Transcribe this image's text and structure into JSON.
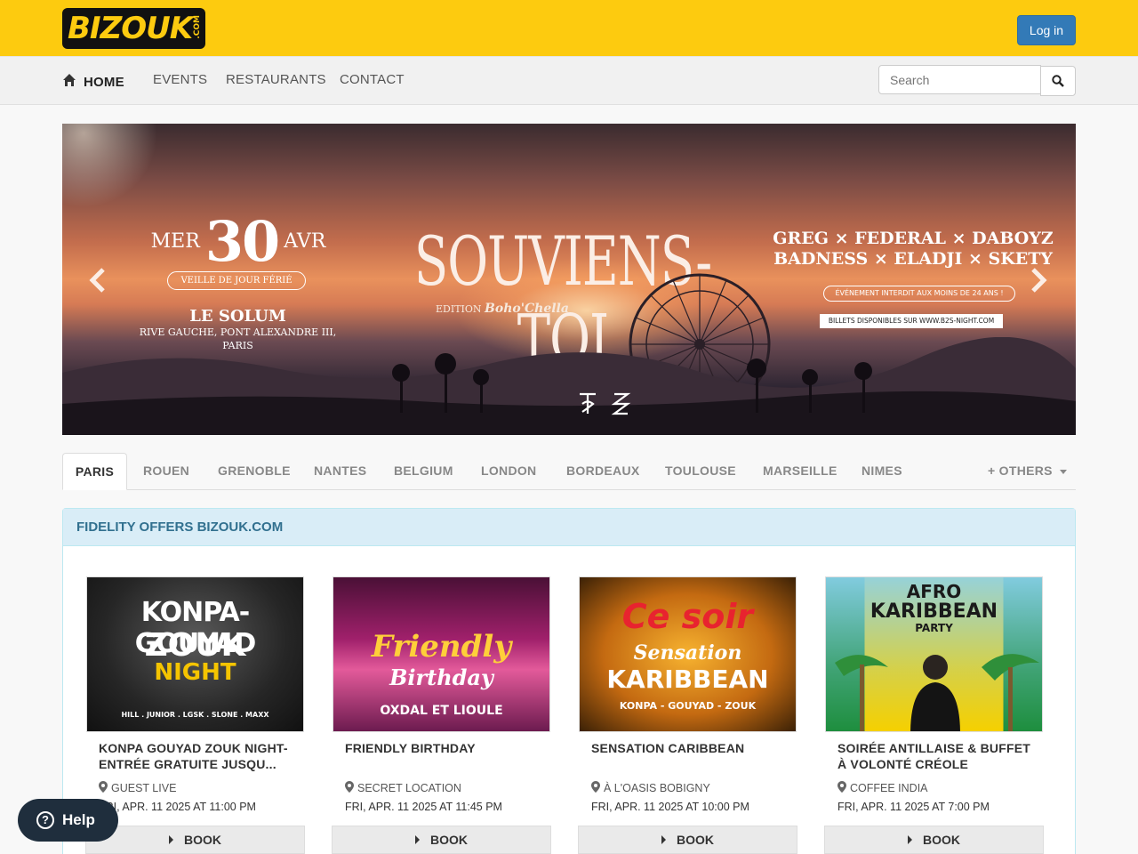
{
  "header": {
    "logo_text": "BIZOUK",
    "logo_suffix": ".COM",
    "login_label": "Log in"
  },
  "nav": {
    "home": "HOME",
    "events": "EVENTS",
    "restaurants": "RESTAURANTS",
    "contact": "CONTACT",
    "search_placeholder": "Search"
  },
  "banner": {
    "day": "MER",
    "date_num": "30",
    "month": "AVR",
    "veille": "VEILLE DE JOUR FÉRIÉ",
    "venue": "LE SOLUM",
    "address1": "RIVE GAUCHE, PONT ALEXANDRE III,",
    "address2": "PARIS",
    "title": "SOUVIENS-TOI",
    "edition": "EDITION",
    "edition_name": "Boho'Chella",
    "artists1": "GREG × FEDERAL × DABOYZ",
    "artists2": "BADNESS × ELADJI × SKETY",
    "warning": "ÉVÉNEMENT INTERDIT AUX MOINS DE 24 ANS !",
    "tickets": "BILLETS DISPONIBLES SUR WWW.B2S-NIGHT.COM",
    "prev_icon": "chevron-left-icon",
    "next_icon": "chevron-right-icon"
  },
  "cities": {
    "tabs": [
      "PARIS",
      "ROUEN",
      "GRENOBLE",
      "NANTES",
      "BELGIUM",
      "LONDON",
      "BORDEAUX",
      "TOULOUSE",
      "MARSEILLE",
      "NIMES"
    ],
    "others": "+ OTHERS"
  },
  "panel": {
    "heading": "FIDELITY OFFERS BIZOUK.COM"
  },
  "cards": [
    {
      "poster_line1": "KONPA-GOUYAD",
      "poster_line2": "ZOUK",
      "poster_line3": "NIGHT",
      "poster_footer": "HILL . JUNIOR . LGSK . SLONE . MAXX",
      "title": "KONPA GOUYAD ZOUK NIGHT-ENTRÉE GRATUITE JUSQU...",
      "location": "GUEST LIVE",
      "date": "FRI, APR. 11 2025 AT 11:00 PM",
      "book": "BOOK"
    },
    {
      "poster_line1": "Friendly",
      "poster_line2": "Birthday",
      "poster_line3": "OXDAL ET LIOULE",
      "title": "FRIENDLY BIRTHDAY",
      "location": "SECRET LOCATION",
      "date": "FRI, APR. 11 2025 AT 11:45 PM",
      "book": "BOOK"
    },
    {
      "poster_line1": "Ce soir",
      "poster_line2": "Sensation",
      "poster_line3": "KARIBBEAN",
      "poster_footer": "KONPA - GOUYAD - ZOUK",
      "title": "SENSATION CARIBBEAN",
      "location": "À L'OASIS BOBIGNY",
      "date": "FRI, APR. 11 2025 AT 10:00 PM",
      "book": "BOOK"
    },
    {
      "poster_line1": "AFRO",
      "poster_line2": "KARIBBEAN",
      "poster_line3": "PARTY",
      "title": "SOIRÉE ANTILLAISE & BUFFET À VOLONTÉ CRÉOLE",
      "location": "COFFEE INDIA",
      "date": "FRI, APR. 11 2025 AT 7:00 PM",
      "book": "BOOK"
    }
  ],
  "help": {
    "label": "Help"
  },
  "colors": {
    "brand_yellow": "#fdcb0f",
    "primary_blue": "#337ab7",
    "panel_heading": "#d9edf7"
  }
}
